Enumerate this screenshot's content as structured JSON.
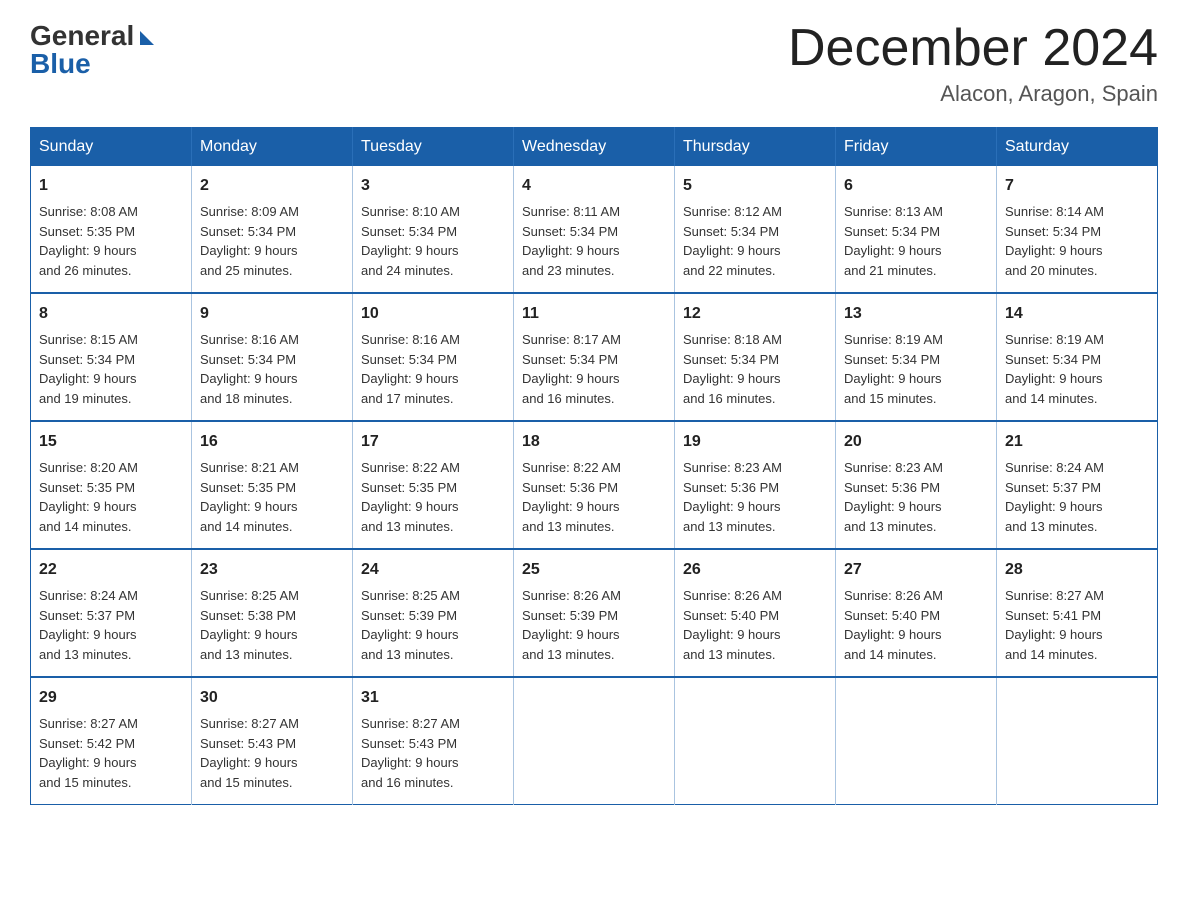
{
  "logo": {
    "general": "General",
    "blue": "Blue"
  },
  "title": {
    "month": "December 2024",
    "location": "Alacon, Aragon, Spain"
  },
  "days_of_week": [
    "Sunday",
    "Monday",
    "Tuesday",
    "Wednesday",
    "Thursday",
    "Friday",
    "Saturday"
  ],
  "weeks": [
    [
      {
        "day": "1",
        "sunrise": "8:08 AM",
        "sunset": "5:35 PM",
        "daylight": "9 hours and 26 minutes."
      },
      {
        "day": "2",
        "sunrise": "8:09 AM",
        "sunset": "5:34 PM",
        "daylight": "9 hours and 25 minutes."
      },
      {
        "day": "3",
        "sunrise": "8:10 AM",
        "sunset": "5:34 PM",
        "daylight": "9 hours and 24 minutes."
      },
      {
        "day": "4",
        "sunrise": "8:11 AM",
        "sunset": "5:34 PM",
        "daylight": "9 hours and 23 minutes."
      },
      {
        "day": "5",
        "sunrise": "8:12 AM",
        "sunset": "5:34 PM",
        "daylight": "9 hours and 22 minutes."
      },
      {
        "day": "6",
        "sunrise": "8:13 AM",
        "sunset": "5:34 PM",
        "daylight": "9 hours and 21 minutes."
      },
      {
        "day": "7",
        "sunrise": "8:14 AM",
        "sunset": "5:34 PM",
        "daylight": "9 hours and 20 minutes."
      }
    ],
    [
      {
        "day": "8",
        "sunrise": "8:15 AM",
        "sunset": "5:34 PM",
        "daylight": "9 hours and 19 minutes."
      },
      {
        "day": "9",
        "sunrise": "8:16 AM",
        "sunset": "5:34 PM",
        "daylight": "9 hours and 18 minutes."
      },
      {
        "day": "10",
        "sunrise": "8:16 AM",
        "sunset": "5:34 PM",
        "daylight": "9 hours and 17 minutes."
      },
      {
        "day": "11",
        "sunrise": "8:17 AM",
        "sunset": "5:34 PM",
        "daylight": "9 hours and 16 minutes."
      },
      {
        "day": "12",
        "sunrise": "8:18 AM",
        "sunset": "5:34 PM",
        "daylight": "9 hours and 16 minutes."
      },
      {
        "day": "13",
        "sunrise": "8:19 AM",
        "sunset": "5:34 PM",
        "daylight": "9 hours and 15 minutes."
      },
      {
        "day": "14",
        "sunrise": "8:19 AM",
        "sunset": "5:34 PM",
        "daylight": "9 hours and 14 minutes."
      }
    ],
    [
      {
        "day": "15",
        "sunrise": "8:20 AM",
        "sunset": "5:35 PM",
        "daylight": "9 hours and 14 minutes."
      },
      {
        "day": "16",
        "sunrise": "8:21 AM",
        "sunset": "5:35 PM",
        "daylight": "9 hours and 14 minutes."
      },
      {
        "day": "17",
        "sunrise": "8:22 AM",
        "sunset": "5:35 PM",
        "daylight": "9 hours and 13 minutes."
      },
      {
        "day": "18",
        "sunrise": "8:22 AM",
        "sunset": "5:36 PM",
        "daylight": "9 hours and 13 minutes."
      },
      {
        "day": "19",
        "sunrise": "8:23 AM",
        "sunset": "5:36 PM",
        "daylight": "9 hours and 13 minutes."
      },
      {
        "day": "20",
        "sunrise": "8:23 AM",
        "sunset": "5:36 PM",
        "daylight": "9 hours and 13 minutes."
      },
      {
        "day": "21",
        "sunrise": "8:24 AM",
        "sunset": "5:37 PM",
        "daylight": "9 hours and 13 minutes."
      }
    ],
    [
      {
        "day": "22",
        "sunrise": "8:24 AM",
        "sunset": "5:37 PM",
        "daylight": "9 hours and 13 minutes."
      },
      {
        "day": "23",
        "sunrise": "8:25 AM",
        "sunset": "5:38 PM",
        "daylight": "9 hours and 13 minutes."
      },
      {
        "day": "24",
        "sunrise": "8:25 AM",
        "sunset": "5:39 PM",
        "daylight": "9 hours and 13 minutes."
      },
      {
        "day": "25",
        "sunrise": "8:26 AM",
        "sunset": "5:39 PM",
        "daylight": "9 hours and 13 minutes."
      },
      {
        "day": "26",
        "sunrise": "8:26 AM",
        "sunset": "5:40 PM",
        "daylight": "9 hours and 13 minutes."
      },
      {
        "day": "27",
        "sunrise": "8:26 AM",
        "sunset": "5:40 PM",
        "daylight": "9 hours and 14 minutes."
      },
      {
        "day": "28",
        "sunrise": "8:27 AM",
        "sunset": "5:41 PM",
        "daylight": "9 hours and 14 minutes."
      }
    ],
    [
      {
        "day": "29",
        "sunrise": "8:27 AM",
        "sunset": "5:42 PM",
        "daylight": "9 hours and 15 minutes."
      },
      {
        "day": "30",
        "sunrise": "8:27 AM",
        "sunset": "5:43 PM",
        "daylight": "9 hours and 15 minutes."
      },
      {
        "day": "31",
        "sunrise": "8:27 AM",
        "sunset": "5:43 PM",
        "daylight": "9 hours and 16 minutes."
      },
      null,
      null,
      null,
      null
    ]
  ],
  "labels": {
    "sunrise": "Sunrise:",
    "sunset": "Sunset:",
    "daylight": "Daylight:"
  }
}
